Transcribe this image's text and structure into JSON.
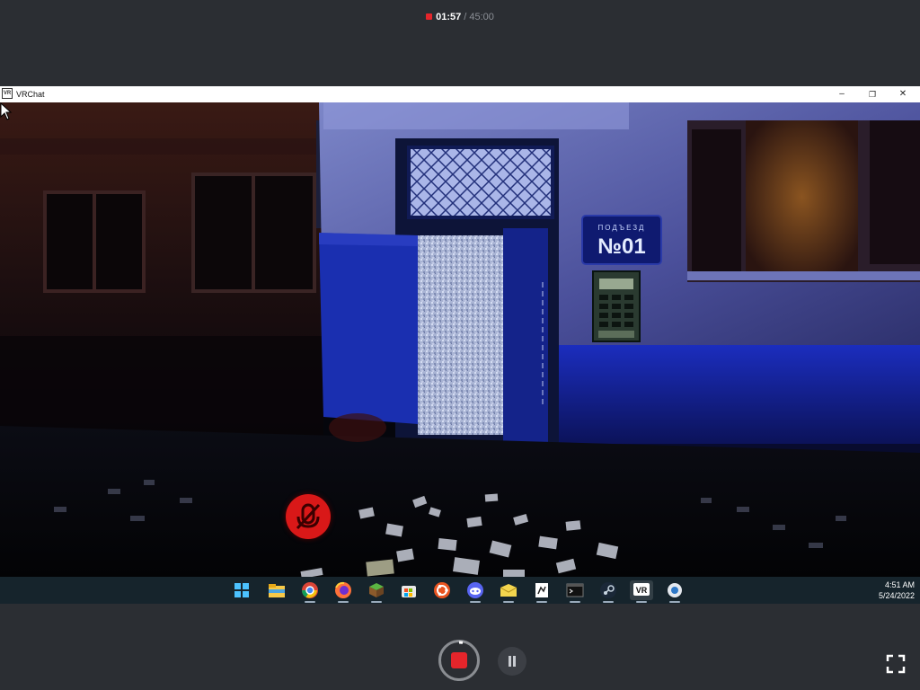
{
  "recorder": {
    "elapsed": "01:57",
    "total": "/ 45:00",
    "stop_icon": "record-stop-icon",
    "pause_icon": "pause-icon",
    "fullscreen_icon": "fullscreen-icon"
  },
  "window": {
    "app_icon_text": "VR",
    "title": "VRChat",
    "minimize": "–",
    "restore": "❐",
    "close": "✕"
  },
  "scene": {
    "sign_top": "ПОДЪЕЗД",
    "sign_number": "№01"
  },
  "taskbar": {
    "icons": [
      "windows-start-icon",
      "file-explorer-icon",
      "chrome-icon",
      "firefox-icon",
      "minecraft-icon",
      "microsoft-store-icon",
      "ubuntu-icon",
      "discord-icon",
      "folder-mail-icon",
      "notepad-icon",
      "terminal-icon",
      "steam-icon",
      "vrchat-icon",
      "obs-icon"
    ],
    "vr_label": "VR",
    "time": "4:51 AM",
    "date": "5/24/2022"
  },
  "colors": {
    "record_red": "#e5252b",
    "taskbar_bg": "#16242c",
    "recorder_bg": "#2b2e33"
  }
}
